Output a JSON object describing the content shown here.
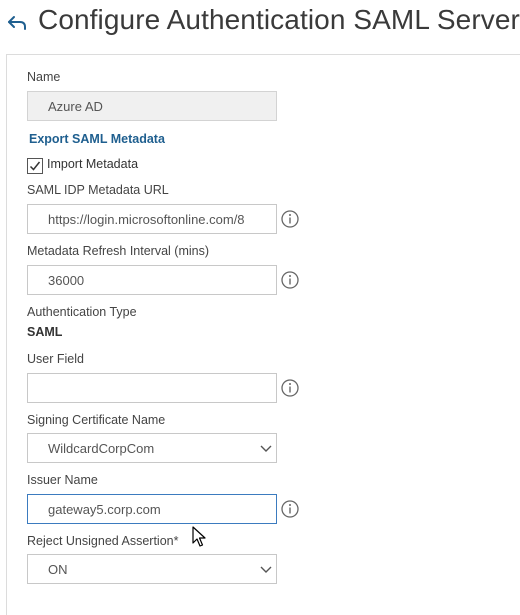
{
  "header": {
    "title": "Configure Authentication SAML Server"
  },
  "form": {
    "name_label": "Name",
    "name_value": "Azure AD",
    "export_link": "Export SAML Metadata",
    "import_metadata_label": "Import Metadata",
    "import_metadata_checked": true,
    "idp_url_label": "SAML IDP Metadata URL",
    "idp_url_value": "https://login.microsoftonline.com/8",
    "refresh_label": "Metadata Refresh Interval (mins)",
    "refresh_value": "36000",
    "auth_type_label": "Authentication Type",
    "auth_type_value": "SAML",
    "user_field_label": "User Field",
    "user_field_value": "",
    "signing_cert_label": "Signing Certificate Name",
    "signing_cert_value": "WildcardCorpCom",
    "issuer_label": "Issuer Name",
    "issuer_value": "gateway5.corp.com",
    "reject_label": "Reject Unsigned Assertion*",
    "reject_value": "ON"
  },
  "icons": {
    "back": "back-arrow-icon",
    "info": "info-icon",
    "chevron": "chevron-down-icon",
    "check": "checkmark-icon",
    "cursor": "mouse-pointer-icon"
  },
  "colors": {
    "link": "#1f5f8f",
    "focus_border": "#3b7bbf",
    "readonly_bg": "#f0f0f0"
  }
}
